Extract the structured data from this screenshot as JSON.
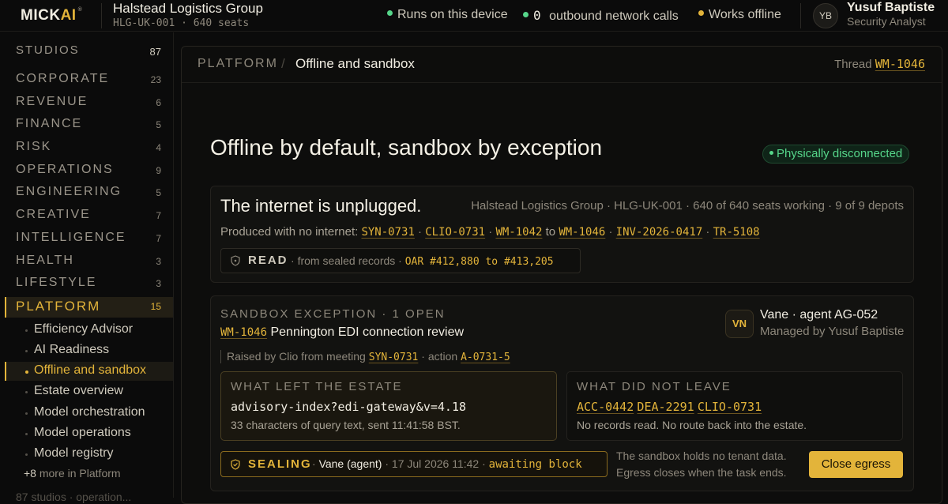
{
  "topbar": {
    "logo_mick": "MICK",
    "logo_ai": "AI",
    "logo_mark": "®",
    "org_name": "Halstead Logistics Group",
    "org_sub": "HLG-UK-001 · 640 seats",
    "stat1": "Runs on this device",
    "stat2_count": "0",
    "stat2_label": "outbound network calls",
    "stat3": "Works offline",
    "user_initials": "YB",
    "user_name": "Yusuf Baptiste",
    "user_role": "Security Analyst"
  },
  "colors": {
    "accent": "#e3b43a",
    "ok": "#56d68a"
  },
  "sidebar": {
    "header": {
      "label": "STUDIOS",
      "count": "87"
    },
    "categories": [
      {
        "label": "CORPORATE",
        "count": "23"
      },
      {
        "label": "REVENUE",
        "count": "6"
      },
      {
        "label": "FINANCE",
        "count": "5"
      },
      {
        "label": "RISK",
        "count": "4"
      },
      {
        "label": "OPERATIONS",
        "count": "9"
      },
      {
        "label": "ENGINEERING",
        "count": "5"
      },
      {
        "label": "CREATIVE",
        "count": "7"
      },
      {
        "label": "INTELLIGENCE",
        "count": "7"
      },
      {
        "label": "HEALTH",
        "count": "3"
      },
      {
        "label": "LIFESTYLE",
        "count": "3"
      },
      {
        "label": "PLATFORM",
        "count": "15"
      }
    ],
    "platform_items": [
      "Efficiency Advisor",
      "AI Readiness",
      "Offline and sandbox",
      "Estate overview",
      "Model orchestration",
      "Model operations",
      "Model registry"
    ],
    "more_num": "+8",
    "more_label": "more in Platform",
    "trail": "87 studios · operation..."
  },
  "header": {
    "root": "PLATFORM",
    "sep": "/",
    "current": "Offline and sandbox",
    "thread_label": "Thread",
    "thread_id": "WM-1046"
  },
  "page": {
    "title": "Offline by default, sandbox by exception",
    "status": "Physically disconnected"
  },
  "summary": {
    "title": "The internet is unplugged.",
    "meta": "Halstead Logistics Group · HLG-UK-001 · 640 of 640 seats working · 9 of 9 depots",
    "produced_label": "Produced with no internet:",
    "ref1": "SYN-0731",
    "ref2": "CLIO-0731",
    "ref3": "WM-1042",
    "to": "to",
    "ref4": "WM-1046",
    "ref5": "INV-2026-0417",
    "ref6": "TR-5108",
    "read_label": "READ",
    "read_from": "from sealed records",
    "read_range": "OAR #412,880 to #413,205"
  },
  "exception": {
    "label": "SANDBOX EXCEPTION · 1 OPEN",
    "ticket": "WM-1046",
    "title": "Pennington EDI connection review",
    "agent_initials": "VN",
    "agent_name": "Vane · agent AG-052",
    "agent_sub": "Managed by Yusuf Baptiste",
    "raised_prefix": "Raised by Clio from meeting",
    "raised_meeting": "SYN-0731",
    "raised_action_label": "· action",
    "raised_action": "A-0731-5",
    "left_label": "WHAT LEFT THE ESTATE",
    "left_query": "advisory-index?edi-gateway&v=4.18",
    "left_sub": "33 characters of query text, sent 11:41:58 BST.",
    "right_label": "WHAT DID NOT LEAVE",
    "right_ref1": "ACC-0442",
    "right_ref2": "DEA-2291",
    "right_ref3": "CLIO-0731",
    "right_sub": "No records read. No route back into the estate.",
    "seal_label": "SEALING",
    "seal_who": "Vane (agent)",
    "seal_time": "17 Jul 2026 11:42",
    "seal_status": "awaiting block",
    "note1": "The sandbox holds no tenant data.",
    "note2": "Egress closes when the task ends.",
    "button": "Close egress"
  }
}
